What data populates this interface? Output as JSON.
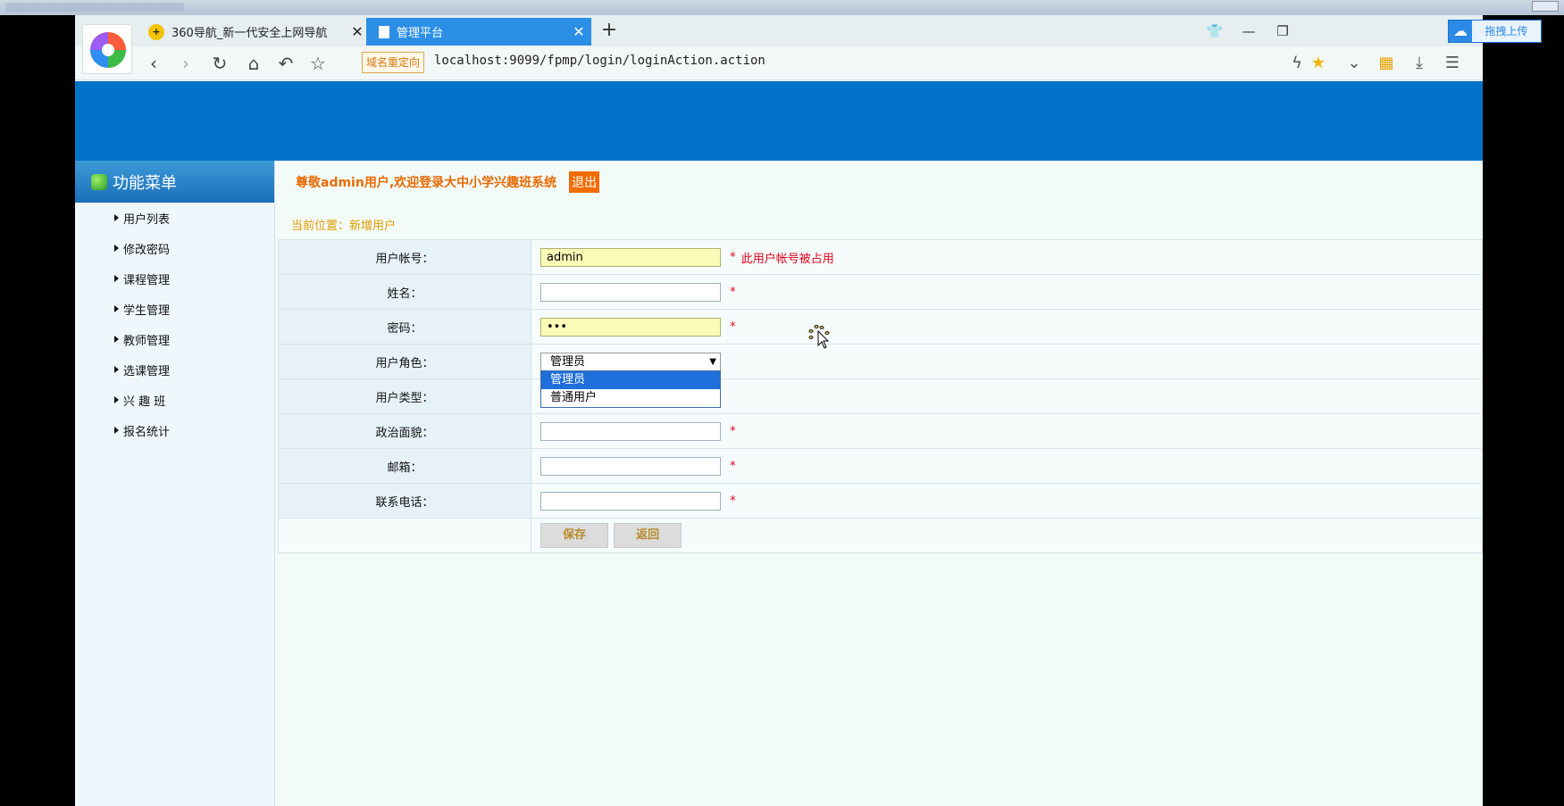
{
  "browser": {
    "tabs": [
      {
        "title": "360导航_新一代安全上网导航",
        "active": false
      },
      {
        "title": "管理平台",
        "active": true
      }
    ],
    "new_tab": "+",
    "upload_label": "拖拽上传",
    "redirect_badge": "域名重定向",
    "url": "localhost:9099/fpmp/login/loginAction.action"
  },
  "sidebar": {
    "title": "功能菜单",
    "items": [
      {
        "label": "用户列表"
      },
      {
        "label": "修改密码"
      },
      {
        "label": "课程管理"
      },
      {
        "label": "学生管理"
      },
      {
        "label": "教师管理"
      },
      {
        "label": "选课管理"
      },
      {
        "label": "兴 趣 班"
      },
      {
        "label": "报名统计"
      }
    ]
  },
  "header": {
    "welcome": "尊敬admin用户,欢迎登录大中小学兴趣班系统",
    "logout": "退出"
  },
  "breadcrumb": "当前位置：新增用户",
  "form": {
    "account_label": "用户帐号：",
    "account_value": "admin",
    "account_warning": "此用户帐号被占用",
    "name_label": "姓名：",
    "name_value": "",
    "password_label": "密码：",
    "password_value": "•••",
    "role_label": "用户角色：",
    "role_value": "管理员",
    "role_options": [
      "管理员",
      "普通用户"
    ],
    "type_label": "用户类型：",
    "politics_label": "政治面貌：",
    "politics_value": "",
    "email_label": "邮箱：",
    "email_value": "",
    "phone_label": "联系电话：",
    "phone_value": "",
    "required_mark": "*",
    "save": "保存",
    "back": "返回"
  },
  "colors": {
    "banner": "#0073c8",
    "accent_orange": "#e86a00",
    "required_red": "#e5001a",
    "active_tab": "#2b8fe8"
  }
}
